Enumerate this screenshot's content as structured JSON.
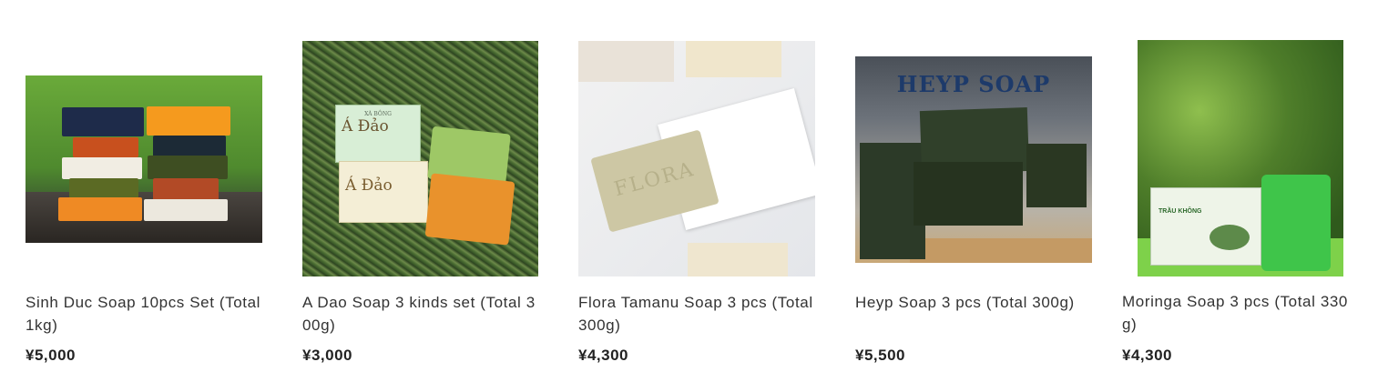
{
  "products": [
    {
      "title": "Sinh Duc Soap 10pcs Set (Total 1kg)",
      "price": "¥5,000",
      "image_alt": "Stacked colorful soap bars tied with twine"
    },
    {
      "title": "A Dao Soap 3 kinds set (Total 300g)",
      "price": "¥3,000",
      "image_alt": "A Dao soap boxes and bars on green grass",
      "box_brand": "XÀ BÔNG",
      "box_name": "Á Đảo"
    },
    {
      "title": "Flora Tamanu Soap 3 pcs (Total 300g)",
      "price": "¥4,300",
      "image_alt": "Flora soap bar with paper box",
      "bar_text": "FLORA"
    },
    {
      "title": "Heyp Soap 3 pcs (Total 300g)",
      "price": "¥5,500",
      "image_alt": "Dark green Heyp soap bars on wooden tray",
      "banner_text": "HEYP SOAP"
    },
    {
      "title": "Moringa Soap 3 pcs (Total 330g)",
      "price": "¥4,300",
      "image_alt": "Green moringa soap with box in front of leaves",
      "box_text": "TRẦU KHÔNG"
    }
  ]
}
